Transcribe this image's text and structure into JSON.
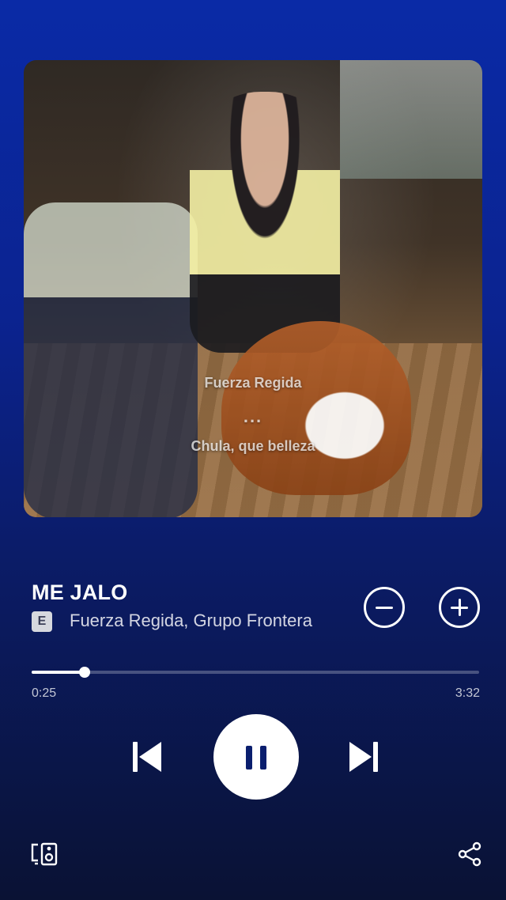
{
  "artwork": {
    "lyrics": {
      "line1": "Fuerza Regida",
      "line2": "...",
      "line3": "Chula, que belleza"
    }
  },
  "track": {
    "title": "ME JALO",
    "explicit_badge": "E",
    "artists": "Fuerza Regida, Grupo Frontera"
  },
  "playback": {
    "elapsed": "0:25",
    "total": "3:32",
    "progress_fraction": 0.118,
    "state": "playing"
  },
  "icons": {
    "remove": "remove-circle-icon",
    "add": "add-circle-icon",
    "previous": "skip-previous-icon",
    "pause": "pause-icon",
    "next": "skip-next-icon",
    "devices": "connect-devices-icon",
    "share": "share-icon"
  },
  "colors": {
    "background_top": "#0a2aa6",
    "background_bottom": "#0a1234",
    "play_button_icon": "#0a1e6e"
  }
}
